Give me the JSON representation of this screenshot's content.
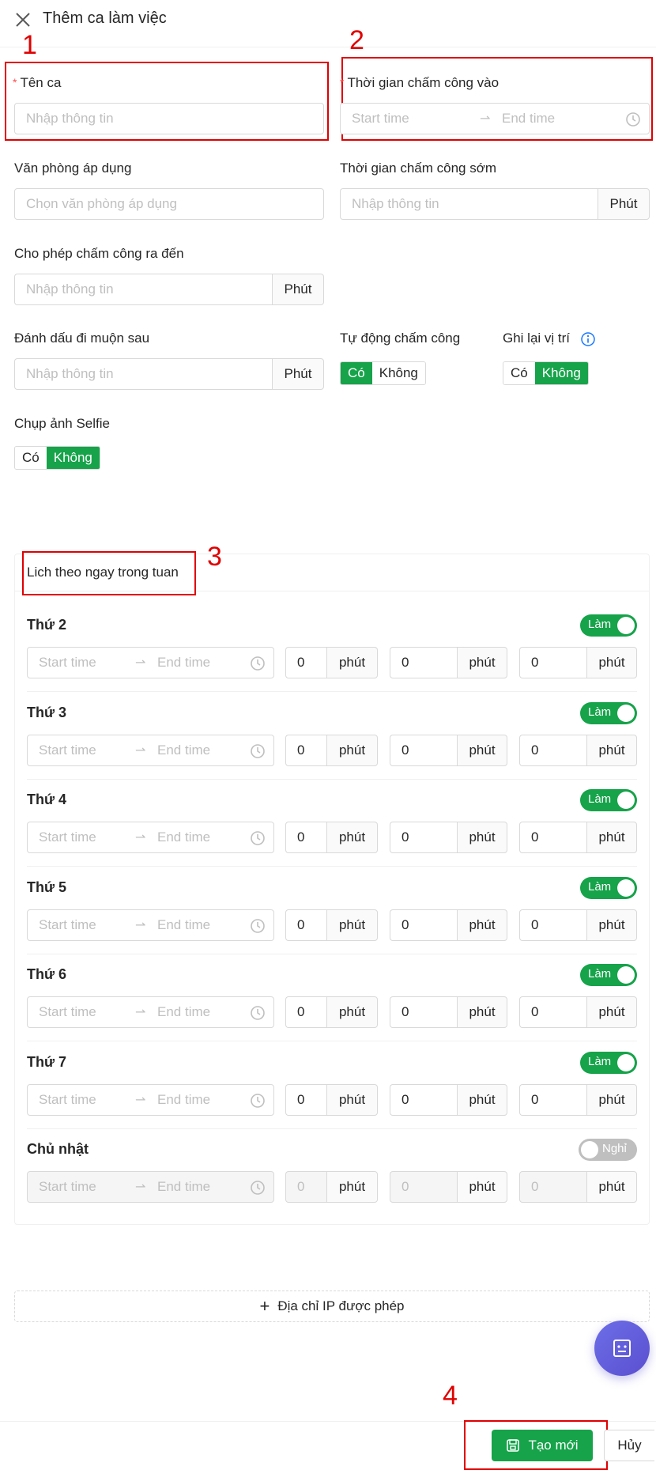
{
  "header": {
    "title": "Thêm ca làm việc"
  },
  "annotations": {
    "n1": "1",
    "n2": "2",
    "n3": "3",
    "n4": "4"
  },
  "form": {
    "shift_name": {
      "label": "Tên ca",
      "placeholder": "Nhập thông tin",
      "required": true
    },
    "checkin_time": {
      "label": "Thời gian chấm công vào",
      "start_placeholder": "Start time",
      "end_placeholder": "End time",
      "required": true
    },
    "office": {
      "label": "Văn phòng áp dụng",
      "placeholder": "Chọn văn phòng áp dụng"
    },
    "early_checkin": {
      "label": "Thời gian chấm công sớm",
      "placeholder": "Nhập thông tin",
      "unit": "Phút"
    },
    "allow_checkout": {
      "label": "Cho phép chấm công ra đến",
      "placeholder": "Nhập thông tin",
      "unit": "Phút"
    },
    "late_mark": {
      "label": "Đánh dấu đi muộn sau",
      "placeholder": "Nhập thông tin",
      "unit": "Phút"
    },
    "auto_checkin": {
      "label": "Tự động chấm công",
      "options": [
        "Có",
        "Không"
      ],
      "selected": "Có"
    },
    "record_location": {
      "label": "Ghi lại vị trí",
      "options": [
        "Có",
        "Không"
      ],
      "selected": "Không"
    },
    "selfie": {
      "label": "Chụp ảnh Selfie",
      "options": [
        "Có",
        "Không"
      ],
      "selected": "Không"
    }
  },
  "schedule": {
    "title": "Lich theo ngay trong tuan",
    "time_start_placeholder": "Start time",
    "time_end_placeholder": "End time",
    "unit": "phút",
    "days": [
      {
        "label": "Thứ 2",
        "status": "Làm",
        "on": true,
        "v1": "0",
        "v2": "0",
        "v3": "0"
      },
      {
        "label": "Thứ 3",
        "status": "Làm",
        "on": true,
        "v1": "0",
        "v2": "0",
        "v3": "0"
      },
      {
        "label": "Thứ 4",
        "status": "Làm",
        "on": true,
        "v1": "0",
        "v2": "0",
        "v3": "0"
      },
      {
        "label": "Thứ 5",
        "status": "Làm",
        "on": true,
        "v1": "0",
        "v2": "0",
        "v3": "0"
      },
      {
        "label": "Thứ 6",
        "status": "Làm",
        "on": true,
        "v1": "0",
        "v2": "0",
        "v3": "0"
      },
      {
        "label": "Thứ 7",
        "status": "Làm",
        "on": true,
        "v1": "0",
        "v2": "0",
        "v3": "0"
      },
      {
        "label": "Chủ nhật",
        "status": "Nghỉ",
        "on": false,
        "v1": "0",
        "v2": "0",
        "v3": "0"
      }
    ]
  },
  "ip_button": {
    "label": "Địa chỉ IP được phép"
  },
  "footer": {
    "create_label": "Tạo mới",
    "cancel_label": "Hủy"
  },
  "colors": {
    "primary": "#16a34a",
    "annotation": "#e00000",
    "fab": "#6d6ee8"
  }
}
